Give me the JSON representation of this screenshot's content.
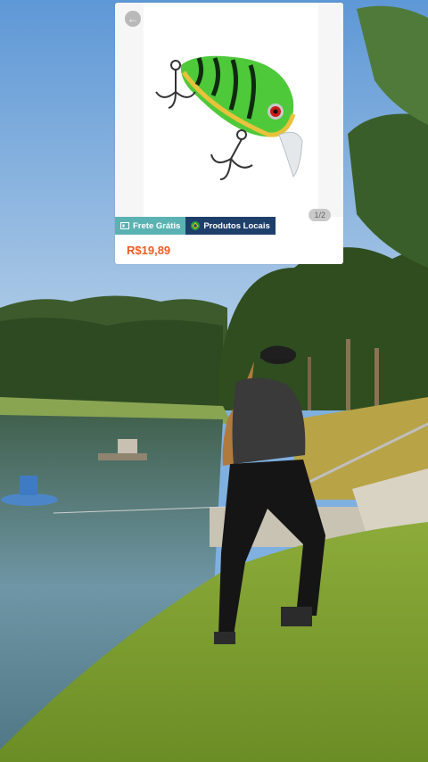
{
  "ad_card": {
    "back_icon": "arrow-left-icon",
    "pager": "1/2",
    "badges": {
      "free_shipping": "Frete Grátis",
      "local_products": "Produtos Locais"
    },
    "price": "R$19,89",
    "product": "fishing lure (green tiger crankbait)"
  },
  "colors": {
    "price": "#f05a24",
    "free_badge": "#5ab3b2",
    "local_badge": "#1f3f6b"
  }
}
